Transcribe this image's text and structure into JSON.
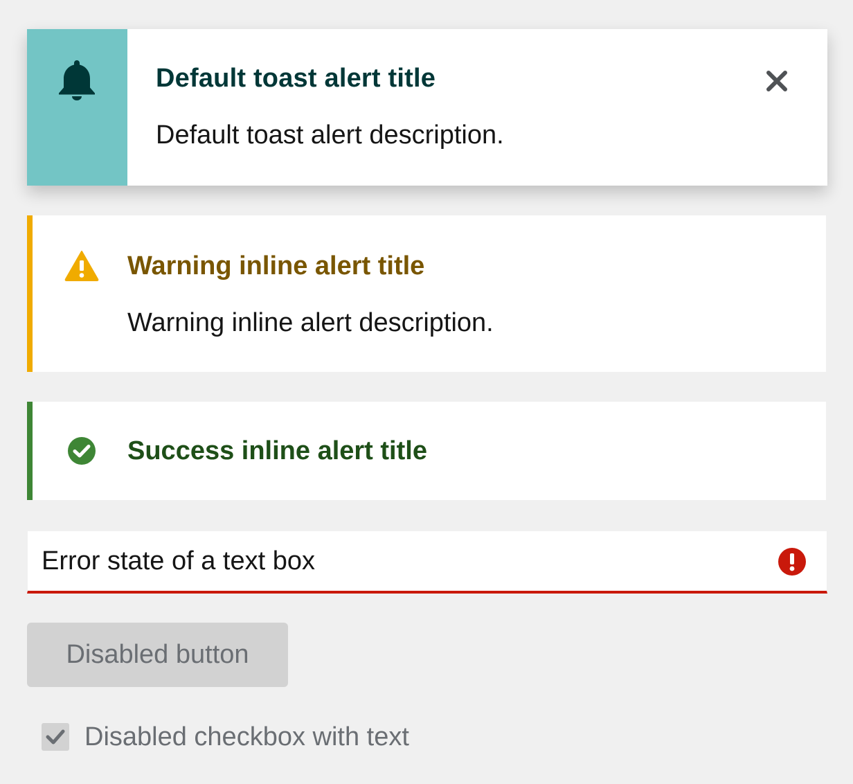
{
  "toast": {
    "title": "Default toast alert title",
    "description": "Default toast alert description.",
    "icon": "bell-icon",
    "close_icon": "close-icon",
    "accent_color": "#73c5c5"
  },
  "warning_alert": {
    "title": "Warning inline alert title",
    "description": "Warning inline alert description.",
    "icon": "warning-triangle-icon",
    "color": "#f0ab00"
  },
  "success_alert": {
    "title": "Success inline alert title",
    "icon": "check-circle-icon",
    "color": "#3e8635"
  },
  "text_box": {
    "value": "Error state of a text box",
    "icon": "exclamation-circle-icon",
    "error_color": "#c9190b"
  },
  "disabled_button": {
    "label": "Disabled button"
  },
  "disabled_checkbox": {
    "label": "Disabled checkbox with text",
    "checked": true
  }
}
